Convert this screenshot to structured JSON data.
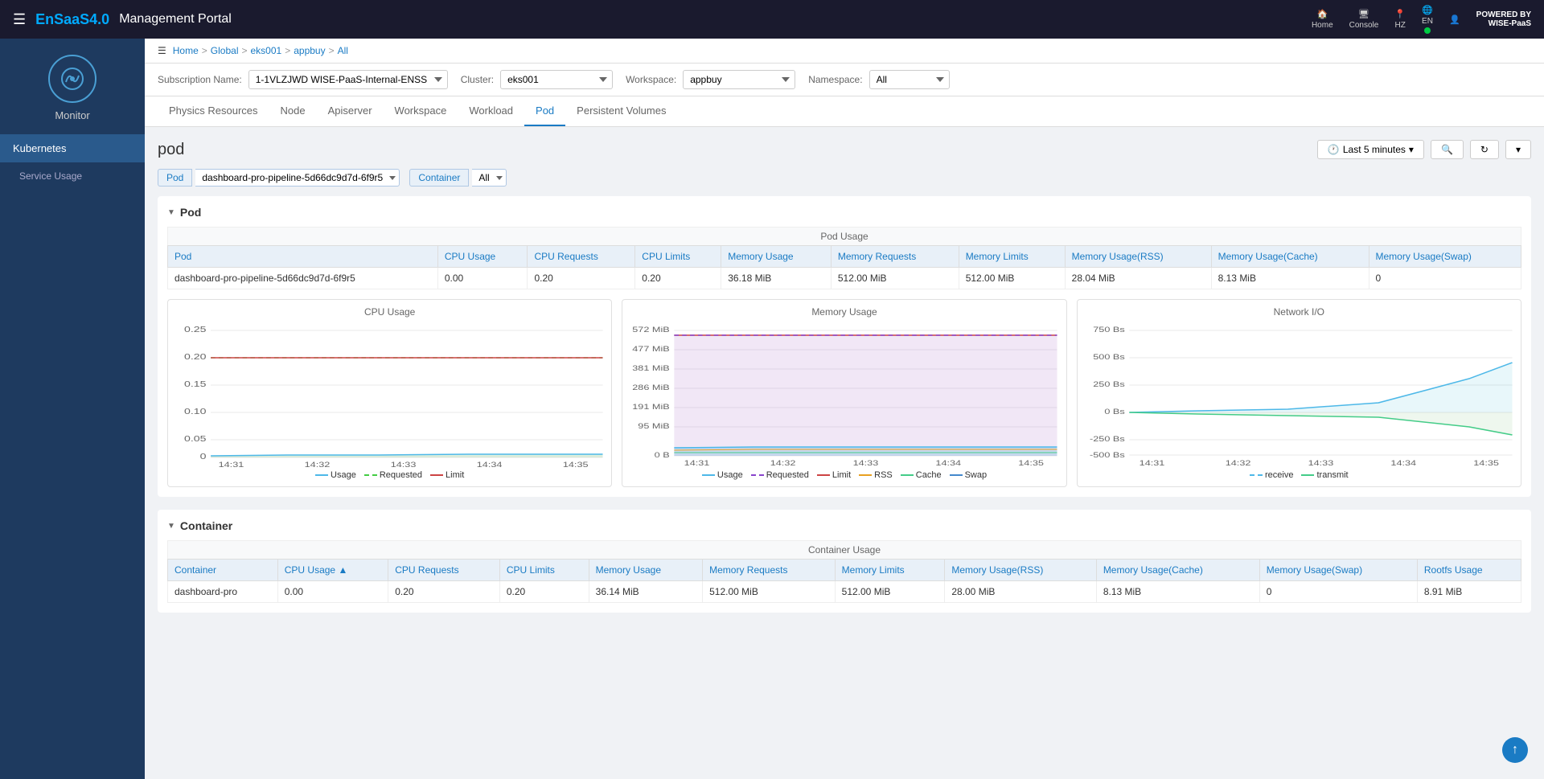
{
  "header": {
    "hamburger": "☰",
    "app_name": "EnSaaS4.0",
    "portal_title": "Management Portal",
    "nav_items": [
      {
        "id": "home",
        "label": "Home",
        "icon": "🏠"
      },
      {
        "id": "console",
        "label": "Console",
        "icon": "🖥"
      },
      {
        "id": "hz",
        "label": "HZ",
        "icon": "📍"
      },
      {
        "id": "en",
        "label": "EN",
        "icon": "🌐"
      },
      {
        "id": "user",
        "label": "",
        "icon": "👤"
      }
    ],
    "powered_by_line1": "POWERED BY",
    "powered_by_line2": "WISE-PaaS"
  },
  "sidebar": {
    "monitor_label": "Monitor",
    "nav_items": [
      {
        "id": "kubernetes",
        "label": "Kubernetes",
        "active": true
      },
      {
        "id": "service-usage",
        "label": "Service Usage",
        "active": false
      }
    ]
  },
  "breadcrumb": {
    "items": [
      "Home",
      "Global",
      "eks001",
      "appbuy",
      "All"
    ]
  },
  "filters": {
    "subscription_label": "Subscription Name:",
    "subscription_id": "1-1VLZJWD",
    "subscription_name": "WISE-PaaS-Internal-ENSS",
    "cluster_label": "Cluster:",
    "cluster_value": "eks001",
    "workspace_label": "Workspace:",
    "workspace_value": "appbuy",
    "namespace_label": "Namespace:",
    "namespace_value": "All"
  },
  "tabs": {
    "items": [
      {
        "id": "physics",
        "label": "Physics Resources",
        "active": false
      },
      {
        "id": "node",
        "label": "Node",
        "active": false
      },
      {
        "id": "apiserver",
        "label": "Apiserver",
        "active": false
      },
      {
        "id": "workspace",
        "label": "Workspace",
        "active": false
      },
      {
        "id": "workload",
        "label": "Workload",
        "active": false
      },
      {
        "id": "pod",
        "label": "Pod",
        "active": true
      },
      {
        "id": "persistent",
        "label": "Persistent Volumes",
        "active": false
      }
    ]
  },
  "page": {
    "title": "pod",
    "time_button": "Last 5 minutes",
    "pod_filter_label": "Pod",
    "pod_filter_value": "dashboard-pro-pipeline-5d66dc9d7d-6f9r5",
    "container_filter_label": "Container",
    "container_filter_value": "All"
  },
  "pod_section": {
    "title": "Pod",
    "table_caption": "Pod Usage",
    "columns": [
      "Pod",
      "CPU Usage",
      "CPU Requests",
      "CPU Limits",
      "Memory Usage",
      "Memory Requests",
      "Memory Limits",
      "Memory Usage(RSS)",
      "Memory Usage(Cache)",
      "Memory Usage(Swap)"
    ],
    "rows": [
      {
        "pod": "dashboard-pro-pipeline-5d66dc9d7d-6f9r5",
        "cpu_usage": "0.00",
        "cpu_requests": "0.20",
        "cpu_limits": "0.20",
        "mem_usage": "36.18 MiB",
        "mem_requests": "512.00 MiB",
        "mem_limits": "512.00 MiB",
        "mem_rss": "28.04 MiB",
        "mem_cache": "8.13 MiB",
        "mem_swap": "0"
      }
    ]
  },
  "cpu_chart": {
    "title": "CPU Usage",
    "y_labels": [
      "0.25",
      "0.20",
      "0.15",
      "0.10",
      "0.05",
      "0"
    ],
    "x_labels": [
      "14:31",
      "14:32",
      "14:33",
      "14:34",
      "14:35"
    ],
    "legend": [
      {
        "label": "Usage",
        "color": "#4db8e8",
        "type": "solid"
      },
      {
        "label": "Requested",
        "color": "#44cc44",
        "type": "dashed"
      },
      {
        "label": "Limit",
        "color": "#cc4444",
        "type": "solid"
      }
    ]
  },
  "memory_chart": {
    "title": "Memory Usage",
    "y_labels": [
      "572 MiB",
      "477 MiB",
      "381 MiB",
      "286 MiB",
      "191 MiB",
      "95 MiB",
      "0 B"
    ],
    "x_labels": [
      "14:31",
      "14:32",
      "14:33",
      "14:34",
      "14:35"
    ],
    "legend": [
      {
        "label": "Usage",
        "color": "#4db8e8"
      },
      {
        "label": "Requested",
        "color": "#8844cc"
      },
      {
        "label": "Limit",
        "color": "#cc4444"
      },
      {
        "label": "RSS",
        "color": "#e8a020"
      },
      {
        "label": "Cache",
        "color": "#44cc88"
      },
      {
        "label": "Swap",
        "color": "#4488cc"
      }
    ]
  },
  "network_chart": {
    "title": "Network I/O",
    "y_labels": [
      "750 Bs",
      "500 Bs",
      "250 Bs",
      "0 Bs",
      "-250 Bs",
      "-500 Bs"
    ],
    "x_labels": [
      "14:31",
      "14:32",
      "14:33",
      "14:34",
      "14:35"
    ],
    "legend": [
      {
        "label": "receive",
        "color": "#4db8e8"
      },
      {
        "label": "transmit",
        "color": "#44cc88"
      }
    ]
  },
  "container_section": {
    "title": "Container",
    "table_caption": "Container Usage",
    "columns": [
      "Container",
      "CPU Usage ▲",
      "CPU Requests",
      "CPU Limits",
      "Memory Usage",
      "Memory Requests",
      "Memory Limits",
      "Memory Usage(RSS)",
      "Memory Usage(Cache)",
      "Memory Usage(Swap)",
      "Rootfs Usage"
    ],
    "rows": [
      {
        "container": "dashboard-pro",
        "cpu_usage": "0.00",
        "cpu_requests": "0.20",
        "cpu_limits": "0.20",
        "mem_usage": "36.14 MiB",
        "mem_requests": "512.00 MiB",
        "mem_limits": "512.00 MiB",
        "mem_rss": "28.00 MiB",
        "mem_cache": "8.13 MiB",
        "mem_swap": "0",
        "rootfs": "8.91 MiB"
      }
    ]
  }
}
